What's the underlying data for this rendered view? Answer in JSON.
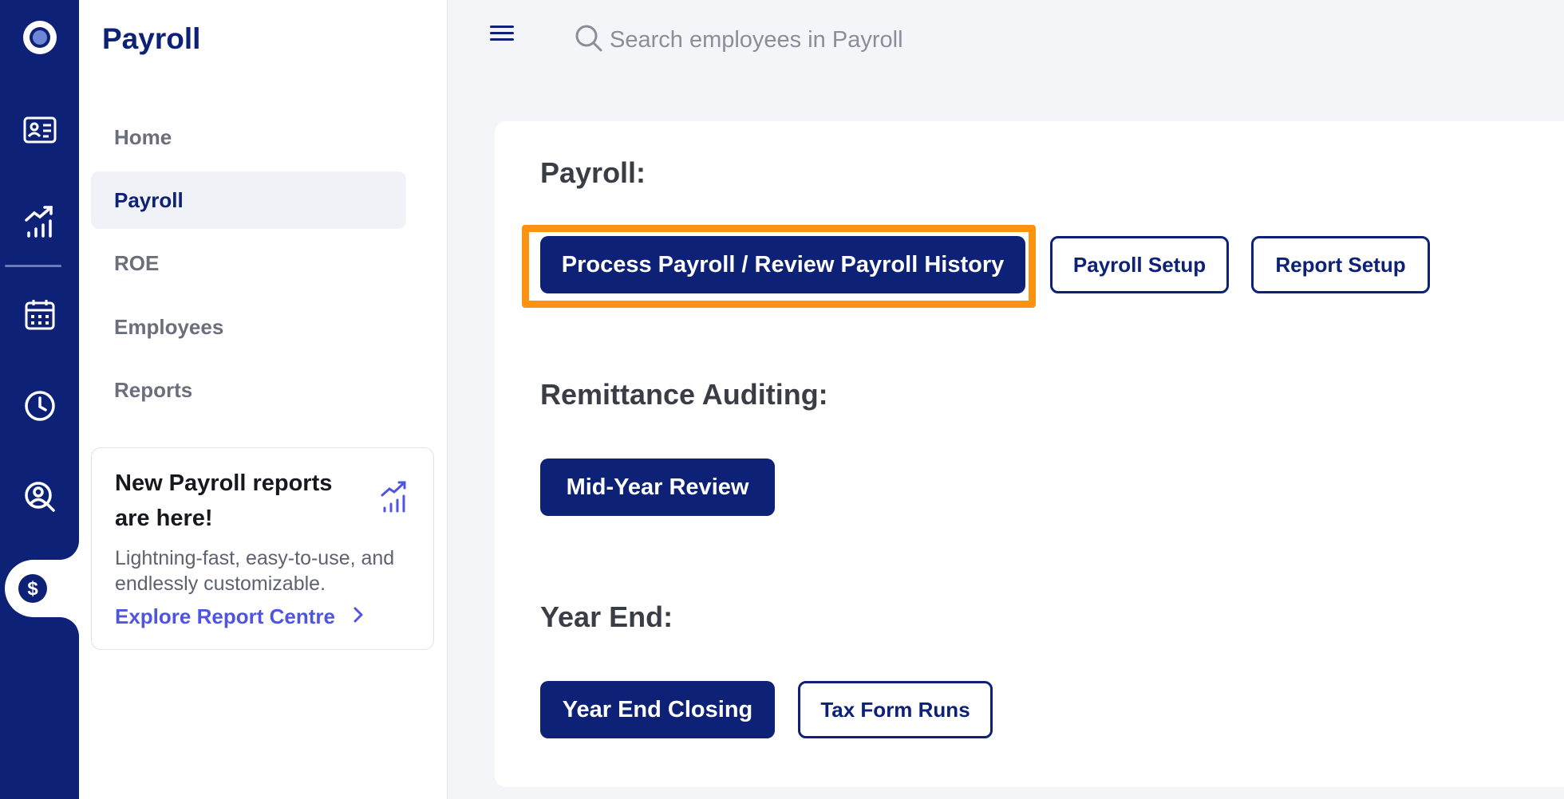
{
  "sidebar": {
    "title": "Payroll",
    "items": [
      {
        "label": "Home"
      },
      {
        "label": "Payroll"
      },
      {
        "label": "ROE"
      },
      {
        "label": "Employees"
      },
      {
        "label": "Reports"
      }
    ],
    "active_item": "Payroll",
    "promo": {
      "title": "New Payroll reports are here!",
      "text": "Lightning-fast, easy-to-use, and endlessly customizable.",
      "link": "Explore Report Centre",
      "icon": "chart-growth-icon"
    }
  },
  "rail": {
    "icons": [
      "logo-icon",
      "id-card-icon",
      "growth-chart-icon",
      "calendar-icon",
      "clock-icon",
      "people-search-icon",
      "dollar-icon"
    ],
    "active_icon": "dollar-icon"
  },
  "topbar": {
    "menu_icon": "hamburger-icon",
    "search_placeholder": "Search employees in Payroll"
  },
  "main": {
    "sections": [
      {
        "title": "Payroll:",
        "buttons": [
          {
            "label": "Process Payroll / Review Payroll History",
            "style": "primary",
            "highlighted": true
          },
          {
            "label": "Payroll Setup",
            "style": "outline"
          },
          {
            "label": "Report Setup",
            "style": "outline"
          }
        ]
      },
      {
        "title": "Remittance Auditing:",
        "buttons": [
          {
            "label": "Mid-Year Review",
            "style": "primary"
          }
        ]
      },
      {
        "title": "Year End:",
        "buttons": [
          {
            "label": "Year End Closing",
            "style": "primary"
          },
          {
            "label": "Tax Form Runs",
            "style": "outline"
          }
        ]
      }
    ]
  },
  "colors": {
    "brand_navy": "#0d2277",
    "highlight_orange": "#fb9310",
    "link_purple": "#4f55e0",
    "background": "#f4f5f9"
  }
}
